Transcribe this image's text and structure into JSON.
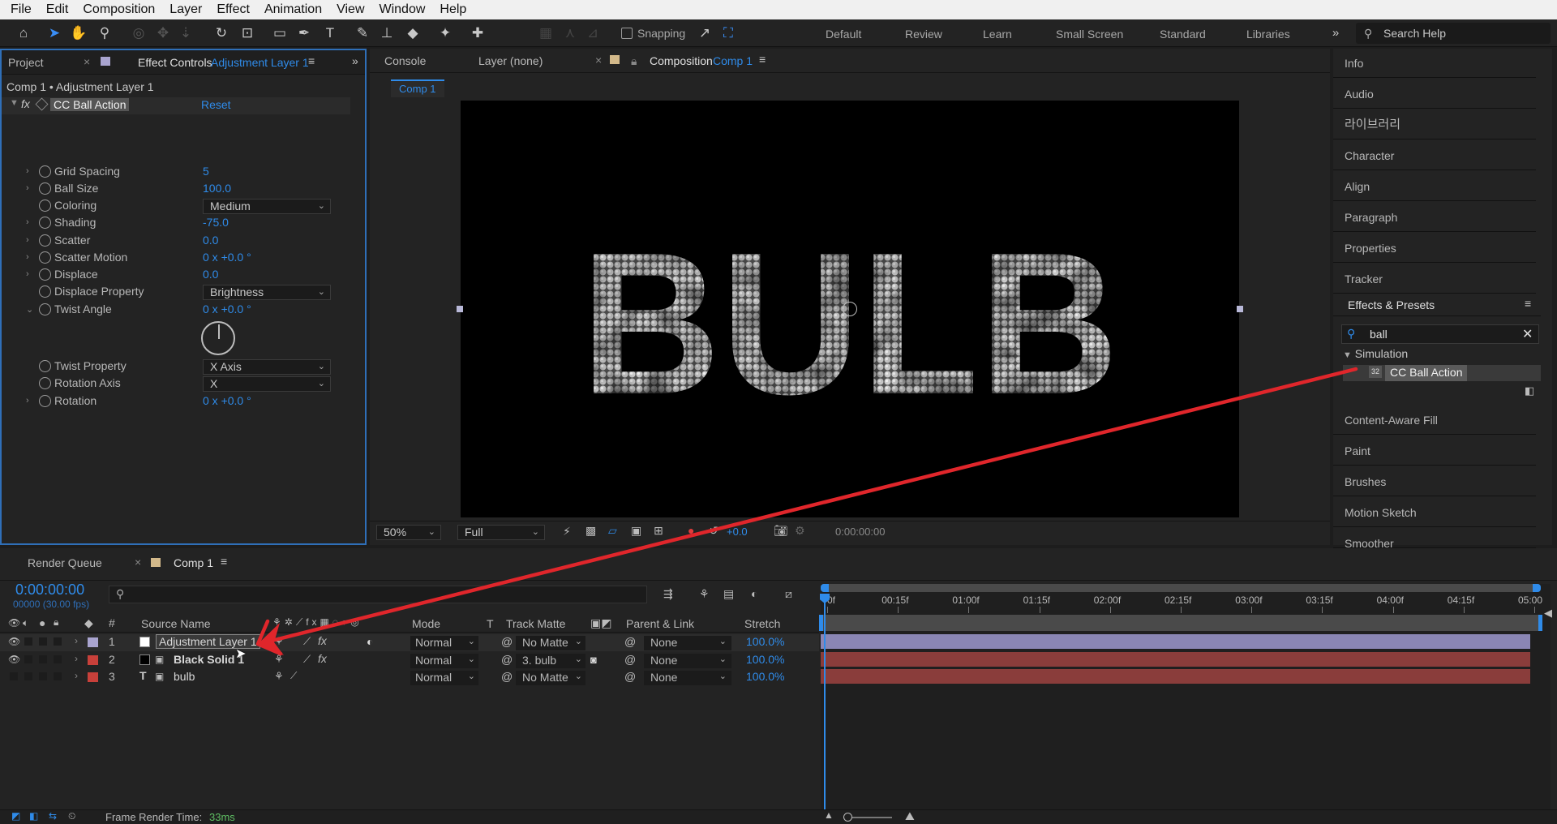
{
  "menu": [
    "File",
    "Edit",
    "Composition",
    "Layer",
    "Effect",
    "Animation",
    "View",
    "Window",
    "Help"
  ],
  "toolbar": {
    "snapping": "Snapping",
    "workspaces": [
      "Default",
      "Review",
      "Learn",
      "Small Screen",
      "Standard",
      "Libraries"
    ],
    "search_help": "Search Help"
  },
  "left_panel": {
    "tab_project": "Project",
    "tab_effect_controls": "Effect Controls",
    "tab_effect_layer": "Adjustment Layer 1",
    "breadcrumb": "Comp 1 • Adjustment Layer 1",
    "effect_name": "CC Ball Action",
    "reset": "Reset",
    "properties": [
      {
        "name": "Grid Spacing",
        "value": "5",
        "twirl": true
      },
      {
        "name": "Ball Size",
        "value": "100.0",
        "twirl": true
      },
      {
        "name": "Coloring",
        "dropdown": "Medium",
        "twirl": false
      },
      {
        "name": "Shading",
        "value": "-75.0",
        "twirl": true
      },
      {
        "name": "Scatter",
        "value": "0.0",
        "twirl": true
      },
      {
        "name": "Scatter Motion",
        "value": "0 x +0.0 °",
        "twirl": true
      },
      {
        "name": "Displace",
        "value": "0.0",
        "twirl": true
      },
      {
        "name": "Displace Property",
        "dropdown": "Brightness",
        "twirl": false
      },
      {
        "name": "Twist Angle",
        "value": "0 x +0.0 °",
        "twirl": true,
        "open": true
      },
      {
        "name": "Twist Property",
        "dropdown": "X Axis",
        "twirl": false
      },
      {
        "name": "Rotation Axis",
        "dropdown": "X",
        "twirl": false
      },
      {
        "name": "Rotation",
        "value": "0 x +0.0 °",
        "twirl": true
      }
    ]
  },
  "comp_panel": {
    "tab_console": "Console",
    "tab_layer": "Layer (none)",
    "tab_composition": "Composition",
    "tab_comp_name": "Comp 1",
    "breadcrumb": "Comp 1",
    "viewer_text": "BULB",
    "zoom": "50%",
    "resolution": "Full",
    "exposure": "+0.0",
    "timecode": "0:00:00:00"
  },
  "right_panel": {
    "items_top": [
      "Info",
      "Audio",
      "라이브러리",
      "Character",
      "Align",
      "Paragraph",
      "Properties",
      "Tracker"
    ],
    "effects_presets": "Effects & Presets",
    "search_value": "ball",
    "category": "Simulation",
    "result": "CC Ball Action",
    "items_bottom": [
      "Content-Aware Fill",
      "Paint",
      "Brushes",
      "Motion Sketch",
      "Smoother"
    ]
  },
  "timeline": {
    "tab_render_queue": "Render Queue",
    "tab_comp": "Comp 1",
    "timecode": "0:00:00:00",
    "frames": "00000 (30.00 fps)",
    "col_source": "Source Name",
    "col_mode": "Mode",
    "col_t": "T",
    "col_track_matte": "Track Matte",
    "col_parent": "Parent & Link",
    "col_stretch": "Stretch",
    "col_num": "#",
    "ruler": [
      "0f",
      "00:15f",
      "01:00f",
      "01:15f",
      "02:00f",
      "02:15f",
      "03:00f",
      "03:15f",
      "04:00f",
      "04:15f",
      "05:00"
    ],
    "layers": [
      {
        "num": "1",
        "name": "Adjustment Layer 1",
        "mode": "Normal",
        "matte": "No Matte",
        "parent": "None",
        "stretch": "100.0%",
        "label": "#a9a4cf",
        "bar": "#8a86b4"
      },
      {
        "num": "2",
        "name": "Black Solid 1",
        "mode": "Normal",
        "matte": "3. bulb",
        "parent": "None",
        "stretch": "100.0%",
        "label": "#c8403a",
        "bar": "#8a3d3b"
      },
      {
        "num": "3",
        "name": "bulb",
        "mode": "Normal",
        "matte": "No Matte",
        "parent": "None",
        "stretch": "100.0%",
        "label": "#c8403a",
        "bar": "#8a3d3b"
      }
    ],
    "render_time_label": "Frame Render Time:",
    "render_time": "33ms"
  },
  "colors": {
    "accent": "#2f8be9",
    "arrow": "#e0262b"
  }
}
